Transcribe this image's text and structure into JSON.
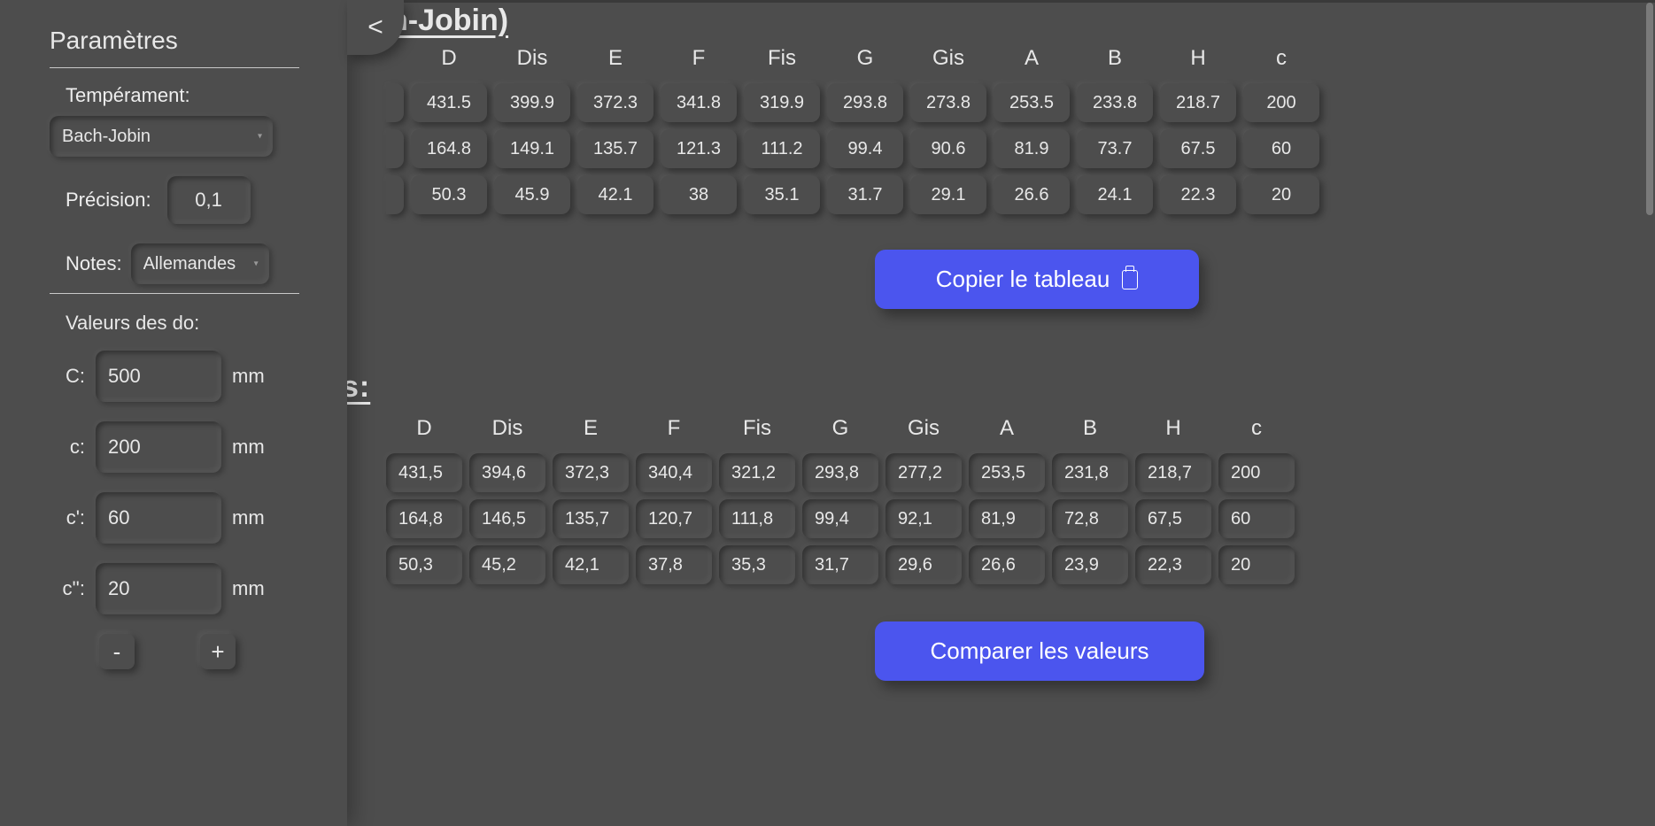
{
  "sidebar": {
    "title": "Paramètres",
    "temperament_label": "Tempérament:",
    "temperament_value": "Bach-Jobin",
    "precision_label": "Précision:",
    "precision_value": "0,1",
    "notes_label": "Notes:",
    "notes_value": "Allemandes",
    "do_title": "Valeurs des do:",
    "do_unit": "mm",
    "do_rows": [
      {
        "label": "C:",
        "value": "500"
      },
      {
        "label": "c:",
        "value": "200"
      },
      {
        "label": "c':",
        "value": "60"
      },
      {
        "label": "c'':",
        "value": "20"
      }
    ],
    "minus": "-",
    "plus": "+"
  },
  "collapse_label": "<",
  "title_fragment1": "h-Jobin)",
  "title_fragment2": "s:",
  "table_headers": [
    "D",
    "Dis",
    "E",
    "F",
    "Fis",
    "G",
    "Gis",
    "A",
    "B",
    "H",
    "c"
  ],
  "table1": {
    "partial": [
      "",
      "",
      ""
    ],
    "rows": [
      [
        "431.5",
        "399.9",
        "372.3",
        "341.8",
        "319.9",
        "293.8",
        "273.8",
        "253.5",
        "233.8",
        "218.7",
        "200"
      ],
      [
        "164.8",
        "149.1",
        "135.7",
        "121.3",
        "111.2",
        "99.4",
        "90.6",
        "81.9",
        "73.7",
        "67.5",
        "60"
      ],
      [
        "50.3",
        "45.9",
        "42.1",
        "38",
        "35.1",
        "31.7",
        "29.1",
        "26.6",
        "24.1",
        "22.3",
        "20"
      ]
    ]
  },
  "table2": {
    "rows": [
      [
        "431,5",
        "394,6",
        "372,3",
        "340,4",
        "321,2",
        "293,8",
        "277,2",
        "253,5",
        "231,8",
        "218,7",
        "200"
      ],
      [
        "164,8",
        "146,5",
        "135,7",
        "120,7",
        "111,8",
        "99,4",
        "92,1",
        "81,9",
        "72,8",
        "67,5",
        "60"
      ],
      [
        "50,3",
        "45,2",
        "42,1",
        "37,8",
        "35,3",
        "31,7",
        "29,6",
        "26,6",
        "23,9",
        "22,3",
        "20"
      ]
    ]
  },
  "copy_btn": "Copier le tableau",
  "compare_btn": "Comparer les valeurs"
}
